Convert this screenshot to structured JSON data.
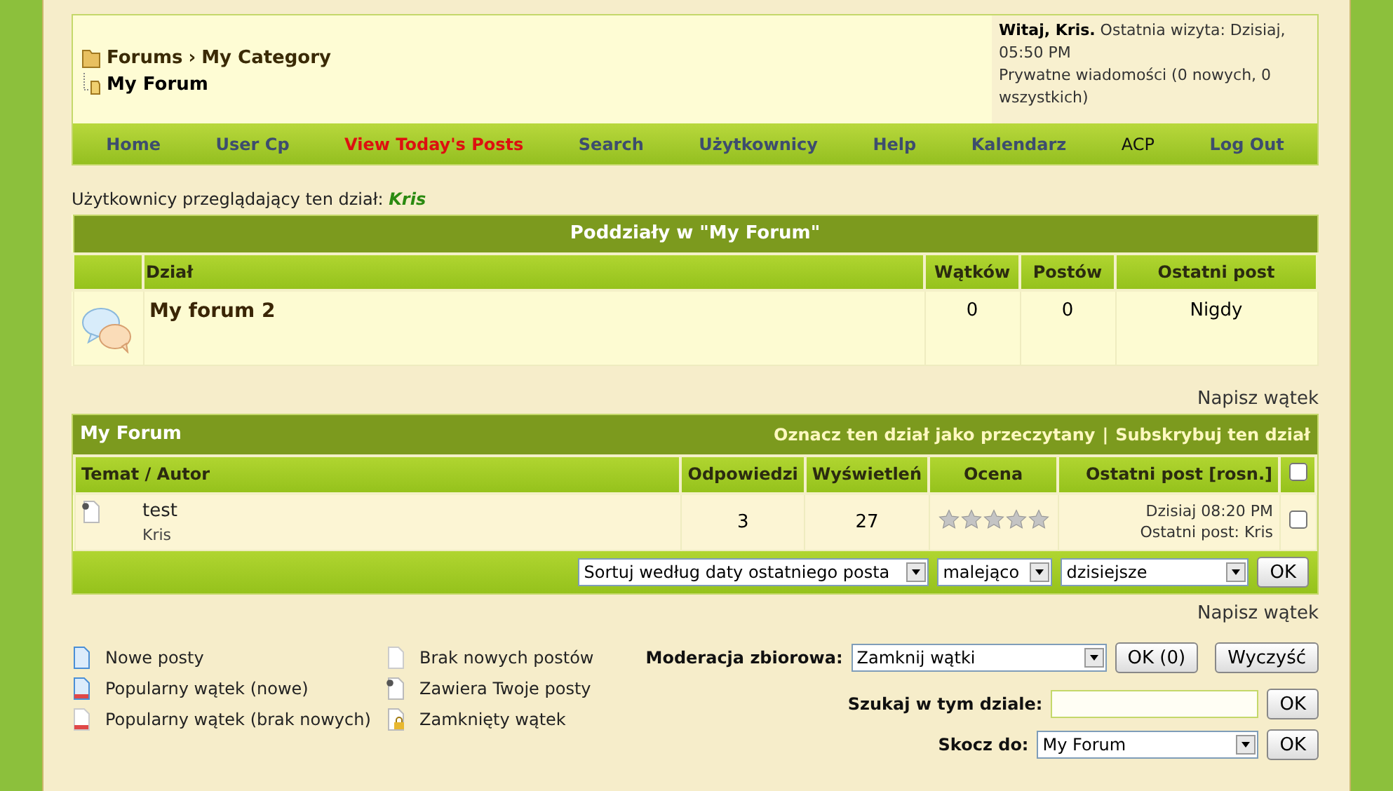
{
  "breadcrumb": {
    "path": [
      "Forums",
      "My Category"
    ],
    "separator": "›",
    "current": "My Forum"
  },
  "welcome": {
    "greeting": "Witaj, Kris.",
    "last_visit": "Ostatnia wizyta: Dzisiaj, 05:50 PM",
    "private_messages": "Prywatne wiadomości (0 nowych, 0 wszystkich)"
  },
  "nav": [
    {
      "label": "Home",
      "kind": "link"
    },
    {
      "label": "User Cp",
      "kind": "link"
    },
    {
      "label": "View Today's Posts",
      "kind": "highlight"
    },
    {
      "label": "Search",
      "kind": "link"
    },
    {
      "label": "Użytkownicy",
      "kind": "link"
    },
    {
      "label": "Help",
      "kind": "link"
    },
    {
      "label": "Kalendarz",
      "kind": "link"
    },
    {
      "label": "ACP",
      "kind": "plain"
    },
    {
      "label": "Log Out",
      "kind": "link"
    }
  ],
  "viewers": {
    "label": "Użytkownicy przeglądający ten dział:",
    "users": "Kris"
  },
  "subforums": {
    "title": "Poddziały w \"My Forum\"",
    "columns": [
      "Dział",
      "Wątków",
      "Postów",
      "Ostatni post"
    ],
    "rows": [
      {
        "name": "My forum 2",
        "threads": "0",
        "posts": "0",
        "last_post": "Nigdy"
      }
    ]
  },
  "new_thread_top": "Napisz wątek",
  "threads": {
    "title": "My Forum",
    "actions": [
      "Oznacz ten dział jako przeczytany",
      "Subskrybuj ten dział"
    ],
    "action_separator": "|",
    "columns": [
      "Temat / Autor",
      "Odpowiedzi",
      "Wyświetleń",
      "Ocena",
      "Ostatni post [rosn.]"
    ],
    "select_all": {
      "checked": false
    },
    "rows": [
      {
        "subject": "test",
        "author": "Kris",
        "replies": "3",
        "views": "27",
        "stars": 0,
        "last_post_date": "Dzisiaj 08:20 PM",
        "last_post_by": "Ostatni post: Kris",
        "checked": false
      }
    ],
    "sort": {
      "selects": [
        "Sortuj według daty ostatniego posta",
        "malejąco",
        "dzisiejsze"
      ],
      "button": "OK"
    }
  },
  "new_thread_bottom": "Napisz wątek",
  "legend": [
    {
      "label": "Nowe posty",
      "kind": "new"
    },
    {
      "label": "Popularny wątek (nowe)",
      "kind": "hot_new"
    },
    {
      "label": "Popularny wątek (brak nowych)",
      "kind": "hot_old"
    },
    {
      "label": "Brak nowych postów",
      "kind": "old"
    },
    {
      "label": "Zawiera Twoje posty",
      "kind": "own"
    },
    {
      "label": "Zamknięty wątek",
      "kind": "locked"
    }
  ],
  "moderation": {
    "label": "Moderacja zbiorowa:",
    "value": "Zamknij wątki",
    "buttons": [
      "OK (0)",
      "Wyczyść"
    ]
  },
  "search": {
    "label": "Szukaj w tym dziale:",
    "button": "OK"
  },
  "jump": {
    "label": "Skocz do:",
    "value": "My Forum",
    "button": "OK"
  }
}
